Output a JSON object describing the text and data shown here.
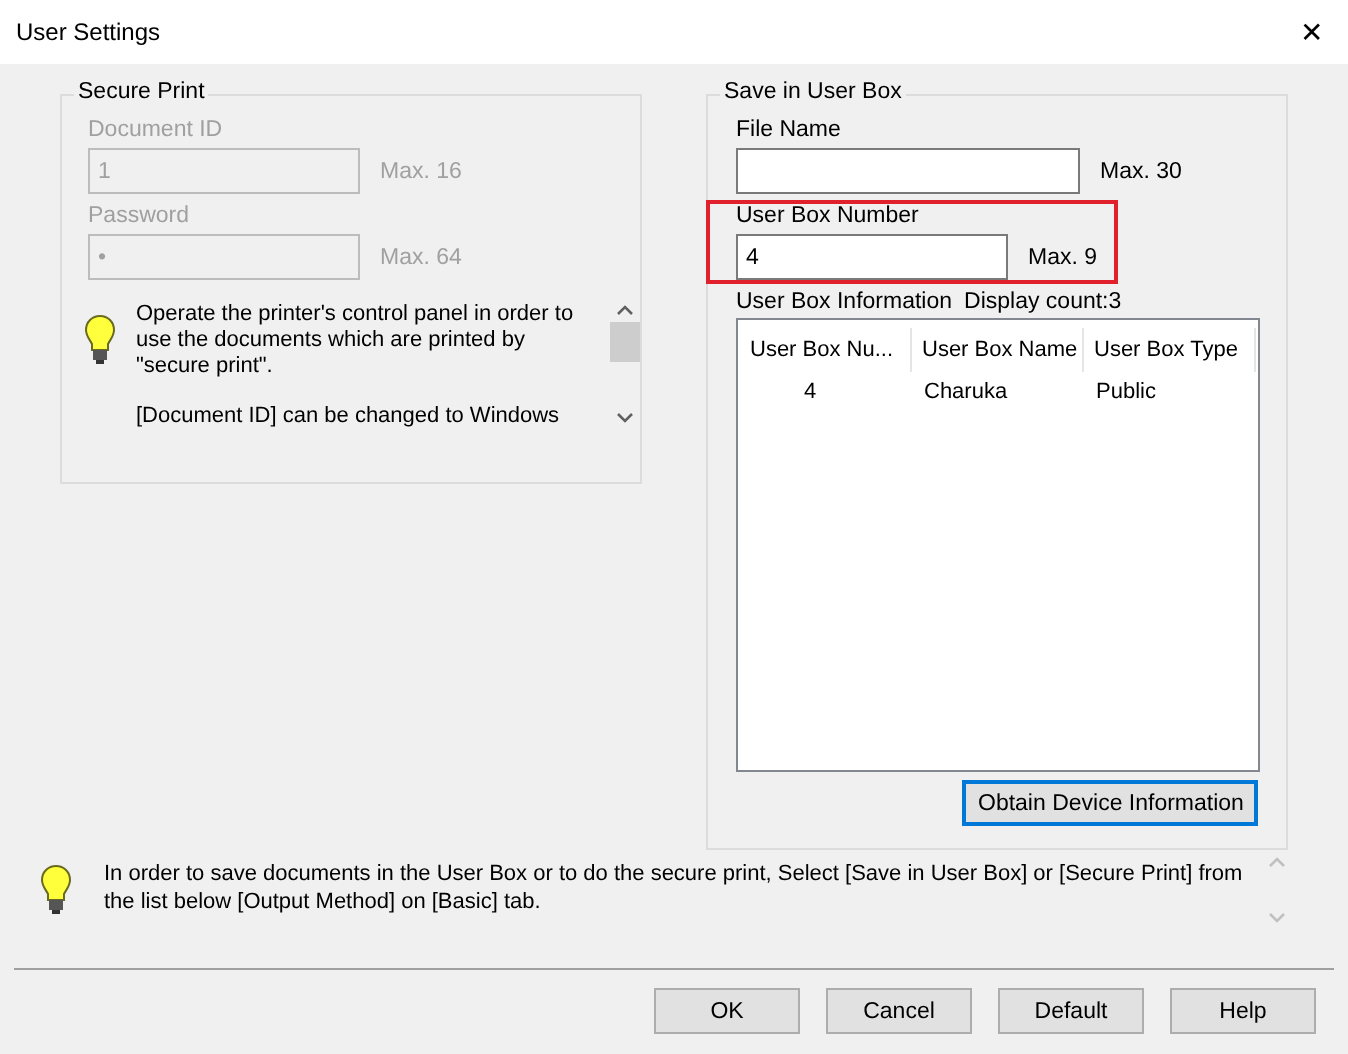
{
  "window": {
    "title": "User Settings",
    "close": "✕"
  },
  "secure_print": {
    "title": "Secure Print",
    "disabled": true,
    "fields": [
      {
        "label": "Document ID",
        "value": "1",
        "max": "Max. 16"
      },
      {
        "label": "Password",
        "value": "•",
        "max": "Max. 64"
      }
    ],
    "hint": [
      "Operate the printer's control panel in order to use the documents which are printed by \"secure print\".",
      "[Document ID] can be changed to Windows"
    ]
  },
  "save_in_user_box": {
    "title": "Save in User Box",
    "fields": [
      {
        "label": "File Name",
        "max": "Max. 30",
        "highlighted": false
      },
      {
        "label": "User Box Number",
        "value": "4",
        "max": "Max. 9",
        "highlighted": true
      }
    ],
    "info_label": "User Box Information",
    "display_count": "Display count:3",
    "table": {
      "columns": [
        "User Box Nu...",
        "User Box Name",
        "User Box Type"
      ],
      "rows": [
        [
          "4",
          "Charuka",
          "Public"
        ]
      ]
    },
    "button": "Obtain Device Information"
  },
  "hint": "In order to save documents in the User Box or to do the secure print, Select [Save in User Box] or [Secure Print] from the list below [Output Method] on [Basic] tab.",
  "buttons": [
    "OK",
    "Cancel",
    "Default",
    "Help"
  ]
}
